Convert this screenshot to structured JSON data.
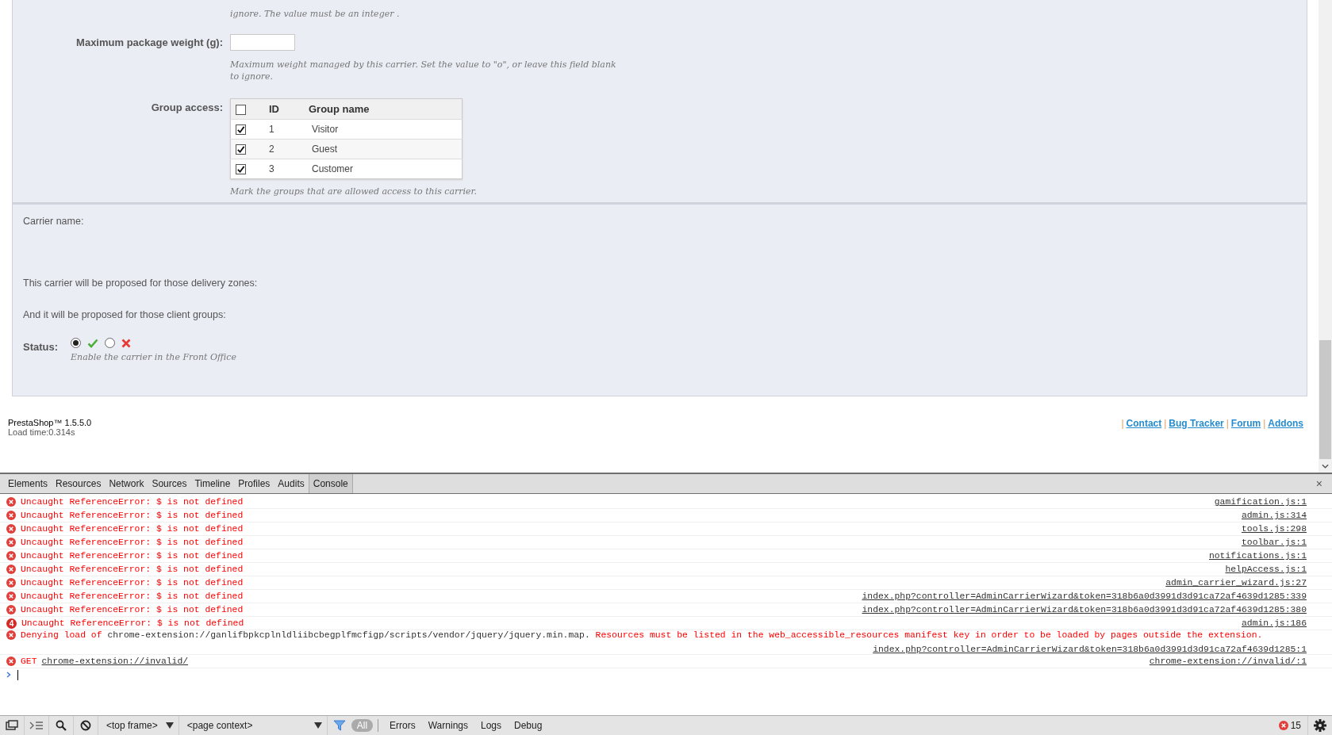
{
  "depth_field": {
    "hint": "ignore. The value must be an integer ."
  },
  "weight_field": {
    "label": "Maximum package weight (g):",
    "hint": "Maximum weight managed by this carrier. Set the value to \"o\", or leave this field blank to ignore."
  },
  "group_access": {
    "label": "Group access:",
    "all_checked": false,
    "columns": [
      "ID",
      "Group name"
    ],
    "rows": [
      {
        "id": "1",
        "name": "Visitor",
        "checked": true
      },
      {
        "id": "2",
        "name": "Guest",
        "checked": true
      },
      {
        "id": "3",
        "name": "Customer",
        "checked": true
      }
    ],
    "hint": "Mark the groups that are allowed access to this carrier."
  },
  "summary": {
    "lines": [
      "Carrier name:",
      "This carrier will be proposed for those delivery zones:",
      "And it will be proposed for those client groups:"
    ],
    "status": {
      "label": "Status:",
      "options": [
        {
          "kind": "enabled",
          "selected": true
        },
        {
          "kind": "disabled",
          "selected": false
        }
      ],
      "hint": "Enable the carrier in the Front Office"
    }
  },
  "footer": {
    "version": "PrestaShop™ 1.5.5.0",
    "load_time": "Load time:0.314s",
    "links": [
      {
        "separator": "|",
        "label": "Contact"
      },
      {
        "separator": "|",
        "label": "Bug Tracker"
      },
      {
        "separator": "|",
        "label": "Forum"
      },
      {
        "separator": "|",
        "label": "Addons"
      }
    ]
  },
  "devtools": {
    "tabs": [
      {
        "label": "Elements",
        "selected": false
      },
      {
        "label": "Resources",
        "selected": false
      },
      {
        "label": "Network",
        "selected": false
      },
      {
        "label": "Sources",
        "selected": false
      },
      {
        "label": "Timeline",
        "selected": false
      },
      {
        "label": "Profiles",
        "selected": false
      },
      {
        "label": "Audits",
        "selected": false
      },
      {
        "label": "Console",
        "selected": true
      }
    ],
    "close": "×",
    "messages": [
      {
        "kind": "error",
        "text": "Uncaught ReferenceError: $ is not defined",
        "source": "gamification.js:1"
      },
      {
        "kind": "error",
        "text": "Uncaught ReferenceError: $ is not defined",
        "source": "admin.js:314"
      },
      {
        "kind": "error",
        "text": "Uncaught ReferenceError: $ is not defined",
        "source": "tools.js:298"
      },
      {
        "kind": "error",
        "text": "Uncaught ReferenceError: $ is not defined",
        "source": "toolbar.js:1"
      },
      {
        "kind": "error",
        "text": "Uncaught ReferenceError: $ is not defined",
        "source": "notifications.js:1"
      },
      {
        "kind": "error",
        "text": "Uncaught ReferenceError: $ is not defined",
        "source": "helpAccess.js:1"
      },
      {
        "kind": "error",
        "text": "Uncaught ReferenceError: $ is not defined",
        "source": "admin_carrier_wizard.js:27"
      },
      {
        "kind": "error",
        "text": "Uncaught ReferenceError: $ is not defined",
        "source": "index.php?controller=AdminCarrierWizard&token=318b6a0d3991d3d91ca72af4639d1285:339"
      },
      {
        "kind": "error",
        "text": "Uncaught ReferenceError: $ is not defined",
        "source": "index.php?controller=AdminCarrierWizard&token=318b6a0d3991d3d91ca72af4639d1285:380"
      },
      {
        "kind": "repeated",
        "count": "4",
        "text": "Uncaught ReferenceError: $ is not defined",
        "source": "admin.js:186"
      },
      {
        "kind": "denied",
        "text": "Denying load of",
        "url": "chrome-extension://ganlifbpkcplnldliibcbegplfmcfigp/scripts/vendor/jquery/jquery.min.map.",
        "detail": "Resources must be listed in the web_accessible_resources manifest key in order to be loaded by pages outside the extension.",
        "source": "index.php?controller=AdminCarrierWizard&token=318b6a0d3991d3d91ca72af4639d1285:1"
      },
      {
        "kind": "network",
        "text": "GET",
        "url": "chrome-extension://invalid/",
        "source": "chrome-extension://invalid/:1"
      }
    ],
    "toolbar": {
      "frame": "<top frame>",
      "context": "<page context>",
      "filters": [
        {
          "label": "All",
          "selected": true
        },
        {
          "label": "Errors",
          "selected": false
        },
        {
          "label": "Warnings",
          "selected": false
        },
        {
          "label": "Logs",
          "selected": false
        },
        {
          "label": "Debug",
          "selected": false
        }
      ],
      "error_count": "15"
    }
  }
}
